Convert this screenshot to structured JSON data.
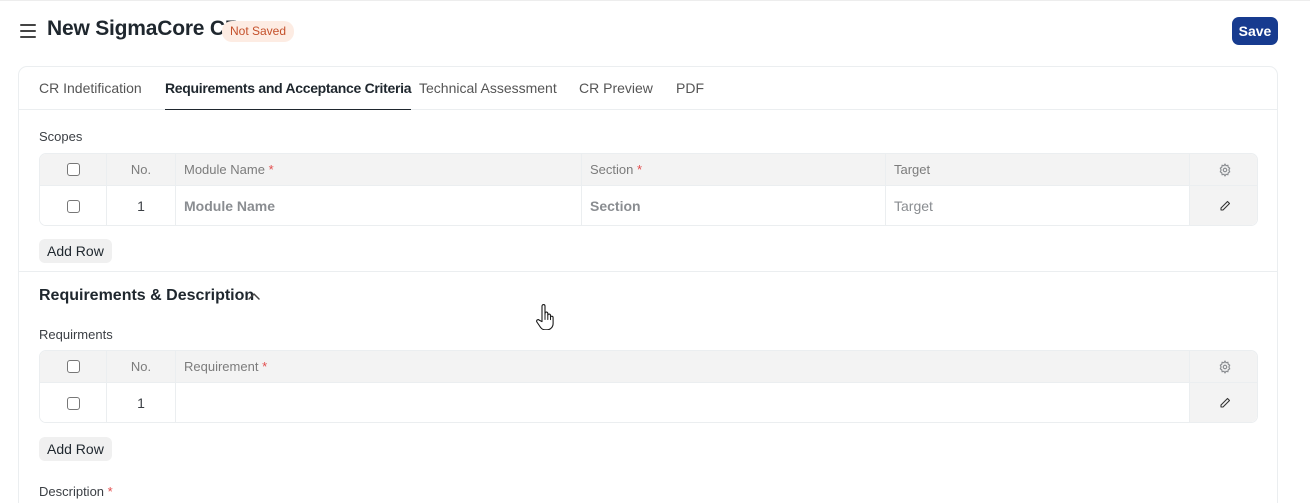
{
  "header": {
    "title": "New SigmaCore CR",
    "status": "Not Saved",
    "save_label": "Save"
  },
  "tabs": [
    {
      "label": "CR Indetification",
      "active": false
    },
    {
      "label": "Requirements and Acceptance Criteria",
      "active": true
    },
    {
      "label": "Technical Assessment",
      "active": false
    },
    {
      "label": "CR Preview",
      "active": false
    },
    {
      "label": "PDF",
      "active": false
    }
  ],
  "scopes": {
    "label": "Scopes",
    "columns": {
      "no": "No.",
      "module_name": "Module Name",
      "section": "Section",
      "target": "Target"
    },
    "required_mark": "*",
    "rows": [
      {
        "no": "1",
        "module_name": "Module Name",
        "section": "Section",
        "target": "Target"
      }
    ],
    "add_row_label": "Add Row"
  },
  "requirements_section": {
    "title": "Requirements & Description",
    "requirements": {
      "label": "Requirments",
      "columns": {
        "no": "No.",
        "requirement": "Requirement"
      },
      "required_mark": "*",
      "rows": [
        {
          "no": "1",
          "requirement": ""
        }
      ],
      "add_row_label": "Add Row"
    },
    "description": {
      "label": "Description",
      "required_mark": "*"
    }
  },
  "colors": {
    "accent": "#173b8f",
    "status_bg": "#fdece3",
    "status_text": "#c4502a",
    "required": "#e24c4c"
  },
  "icons": {
    "menu": "menu-icon",
    "settings": "gear-icon",
    "edit": "pencil-icon",
    "collapse": "chevron-up-icon",
    "cursor": "hand-pointer-icon"
  }
}
